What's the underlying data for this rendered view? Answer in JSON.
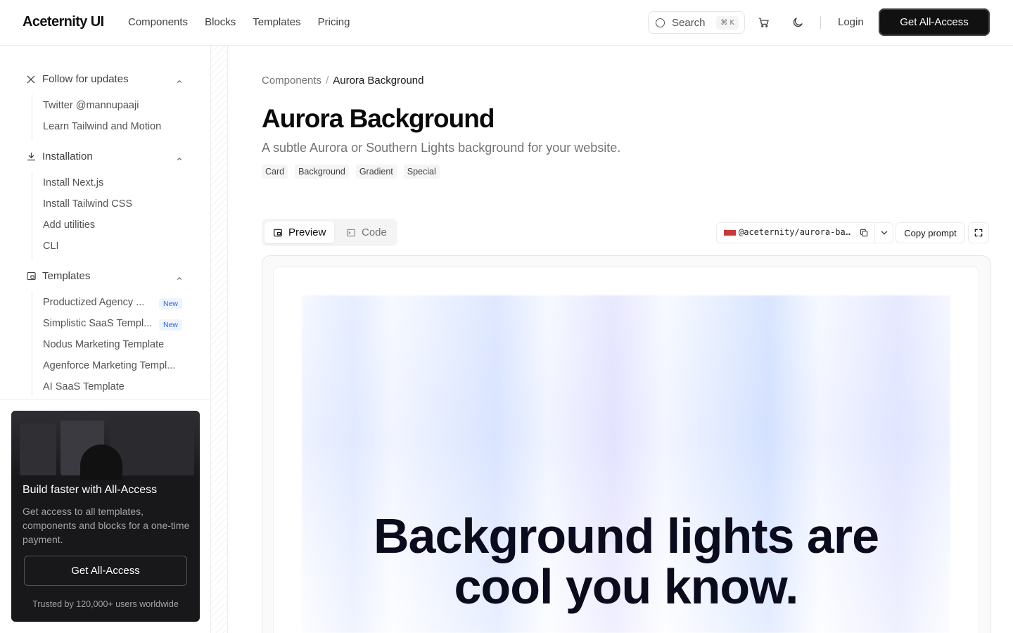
{
  "header": {
    "logo": "Aceternity UI",
    "nav": [
      "Components",
      "Blocks",
      "Templates",
      "Pricing"
    ],
    "search_label": "Search",
    "search_shortcut": "⌘ K",
    "login": "Login",
    "cta": "Get All-Access"
  },
  "sidebar": {
    "sections": [
      {
        "title": "Follow for updates",
        "icon": "x-logo-icon",
        "items": [
          {
            "label": "Twitter @mannupaaji"
          },
          {
            "label": "Learn Tailwind and Motion"
          }
        ]
      },
      {
        "title": "Installation",
        "icon": "download-icon",
        "items": [
          {
            "label": "Install Next.js"
          },
          {
            "label": "Install Tailwind CSS"
          },
          {
            "label": "Add utilities"
          },
          {
            "label": "CLI"
          }
        ]
      },
      {
        "title": "Templates",
        "icon": "template-icon",
        "items": [
          {
            "label": "Productized Agency ...",
            "badge": "New"
          },
          {
            "label": "Simplistic SaaS Templ...",
            "badge": "New"
          },
          {
            "label": "Nodus Marketing Template"
          },
          {
            "label": "Agenforce Marketing Templ..."
          },
          {
            "label": "AI SaaS Template"
          }
        ]
      }
    ],
    "promo": {
      "title": "Build faster with All-Access",
      "description": "Get access to all templates, components and blocks for a one-time payment.",
      "button": "Get All-Access",
      "footer": "Trusted by 120,000+ users worldwide"
    }
  },
  "main": {
    "breadcrumb": {
      "parent": "Components",
      "separator": "/",
      "current": "Aurora Background"
    },
    "title": "Aurora Background",
    "subtitle": "A subtle Aurora or Southern Lights background for your website.",
    "tags": [
      "Card",
      "Background",
      "Gradient",
      "Special"
    ],
    "tabs": {
      "preview": "Preview",
      "code": "Code"
    },
    "package": "@aceternity/aurora-ba…",
    "copy_prompt": "Copy prompt",
    "hero_line1": "Background lights are",
    "hero_line2": "cool you know."
  },
  "colors": {
    "accent_dark": "#111111",
    "badge_blue": "#2563eb",
    "npm_red": "#cb3837"
  }
}
